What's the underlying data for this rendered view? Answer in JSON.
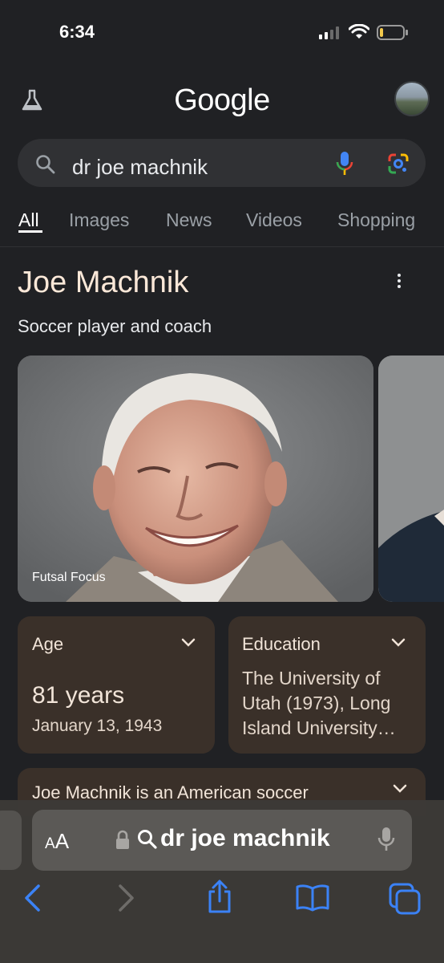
{
  "status_bar": {
    "time": "6:34"
  },
  "header": {
    "logo": "Google",
    "labs_icon": "flask-icon",
    "avatar_icon": "avatar"
  },
  "search": {
    "query": "dr joe machnik",
    "search_icon": "search-icon",
    "mic_icon": "mic-icon",
    "lens_icon": "lens-icon"
  },
  "tabs": [
    {
      "label": "All",
      "active": true
    },
    {
      "label": "Images"
    },
    {
      "label": "News"
    },
    {
      "label": "Videos"
    },
    {
      "label": "Shopping"
    }
  ],
  "knowledge_panel": {
    "title": "Joe Machnik",
    "subtitle": "Soccer player and coach",
    "image_caption": "Futsal Focus",
    "age": {
      "label": "Age",
      "value": "81 years",
      "birth_date": "January 13, 1943"
    },
    "education": {
      "label": "Education",
      "value": "The University of Utah (1973), Long Island University…"
    },
    "description": "Joe Machnik is an American soccer"
  },
  "safari": {
    "text_size_label": "AA",
    "address": "dr joe machnik"
  },
  "colors": {
    "background": "#202124",
    "card": "#3a3029",
    "title": "#fbe8d8",
    "safari_blue": "#3b82f6"
  }
}
